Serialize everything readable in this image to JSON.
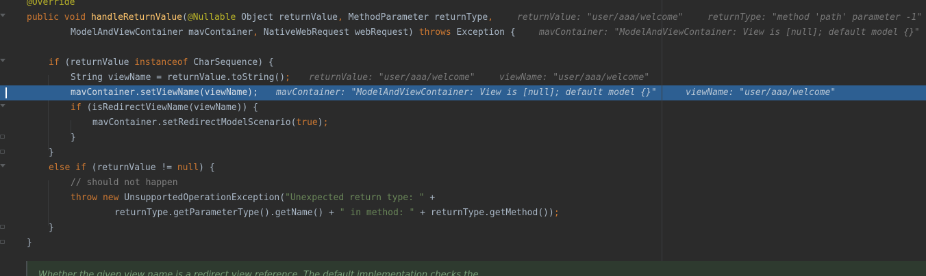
{
  "editor": {
    "lines": [
      {
        "tokens": [
          {
            "t": "@Override",
            "c": "ann"
          }
        ]
      },
      {
        "tokens": [
          {
            "t": "public ",
            "c": "kw"
          },
          {
            "t": "void ",
            "c": "kw"
          },
          {
            "t": "handleReturnValue",
            "c": "fn"
          },
          {
            "t": "("
          },
          {
            "t": "@Nullable",
            "c": "ann"
          },
          {
            "t": " Object returnValue"
          },
          {
            "t": ", ",
            "c": "kw"
          },
          {
            "t": "MethodParameter returnType"
          },
          {
            "t": ",",
            "c": "kw"
          }
        ],
        "hints": [
          "returnValue: \"user/aaa/welcome\"",
          "returnType: \"method 'path' parameter -1\""
        ]
      },
      {
        "tokens": [
          {
            "t": "ModelAndViewContainer mavContainer"
          },
          {
            "t": ", ",
            "c": "kw"
          },
          {
            "t": "NativeWebRequest webRequest) "
          },
          {
            "t": "throws ",
            "c": "kw"
          },
          {
            "t": "Exception {"
          }
        ],
        "hints": [
          "mavContainer: \"ModelAndViewContainer: View is [null]; default model {}\""
        ]
      },
      {
        "tokens": []
      },
      {
        "tokens": [
          {
            "t": "if ",
            "c": "kw"
          },
          {
            "t": "(returnValue "
          },
          {
            "t": "instanceof ",
            "c": "kw"
          },
          {
            "t": "CharSequence) {"
          }
        ]
      },
      {
        "tokens": [
          {
            "t": "String viewName = returnValue.toString()"
          },
          {
            "t": ";",
            "c": "kw"
          }
        ],
        "hints": [
          "returnValue: \"user/aaa/welcome\"",
          "viewName: \"user/aaa/welcome\""
        ]
      },
      {
        "tokens": [
          {
            "t": "mavContainer.setViewName(viewName);"
          }
        ],
        "hints": [
          "mavContainer: \"ModelAndViewContainer: View is [null]; default model {}\"",
          "viewName: \"user/aaa/welcome\""
        ]
      },
      {
        "tokens": [
          {
            "t": "if ",
            "c": "kw"
          },
          {
            "t": "(isRedirectViewName(viewName)) {"
          }
        ]
      },
      {
        "tokens": [
          {
            "t": "mavContainer.setRedirectModelScenario("
          },
          {
            "t": "true",
            "c": "kw"
          },
          {
            "t": ")"
          },
          {
            "t": ";",
            "c": "kw"
          }
        ]
      },
      {
        "tokens": [
          {
            "t": "}"
          }
        ]
      },
      {
        "tokens": [
          {
            "t": "}"
          }
        ]
      },
      {
        "tokens": [
          {
            "t": "else if ",
            "c": "kw"
          },
          {
            "t": "(returnValue != "
          },
          {
            "t": "null",
            "c": "kw"
          },
          {
            "t": ") {"
          }
        ]
      },
      {
        "tokens": [
          {
            "t": "// should not happen",
            "c": "cmt"
          }
        ]
      },
      {
        "tokens": [
          {
            "t": "throw new ",
            "c": "kw"
          },
          {
            "t": "UnsupportedOperationException("
          },
          {
            "t": "\"Unexpected return type: \"",
            "c": "str"
          },
          {
            "t": " +"
          }
        ]
      },
      {
        "tokens": [
          {
            "t": "returnType.getParameterType().getName() + "
          },
          {
            "t": "\" in method: \"",
            "c": "str"
          },
          {
            "t": " + returnType.getMethod())"
          },
          {
            "t": ";",
            "c": "kw"
          }
        ]
      },
      {
        "tokens": [
          {
            "t": "}"
          }
        ]
      },
      {
        "tokens": [
          {
            "t": "}"
          }
        ]
      }
    ],
    "doc_comment": "Whether the given view name is a redirect view reference. The default implementation checks the"
  },
  "colors": {
    "background": "#2b2b2b",
    "keyword": "#cc7832",
    "annotation": "#bbb529",
    "method_declaration": "#ffc66d",
    "string": "#6a8759",
    "comment": "#808080",
    "current_line": "#2d5f92",
    "inline_hint": "#787878"
  }
}
